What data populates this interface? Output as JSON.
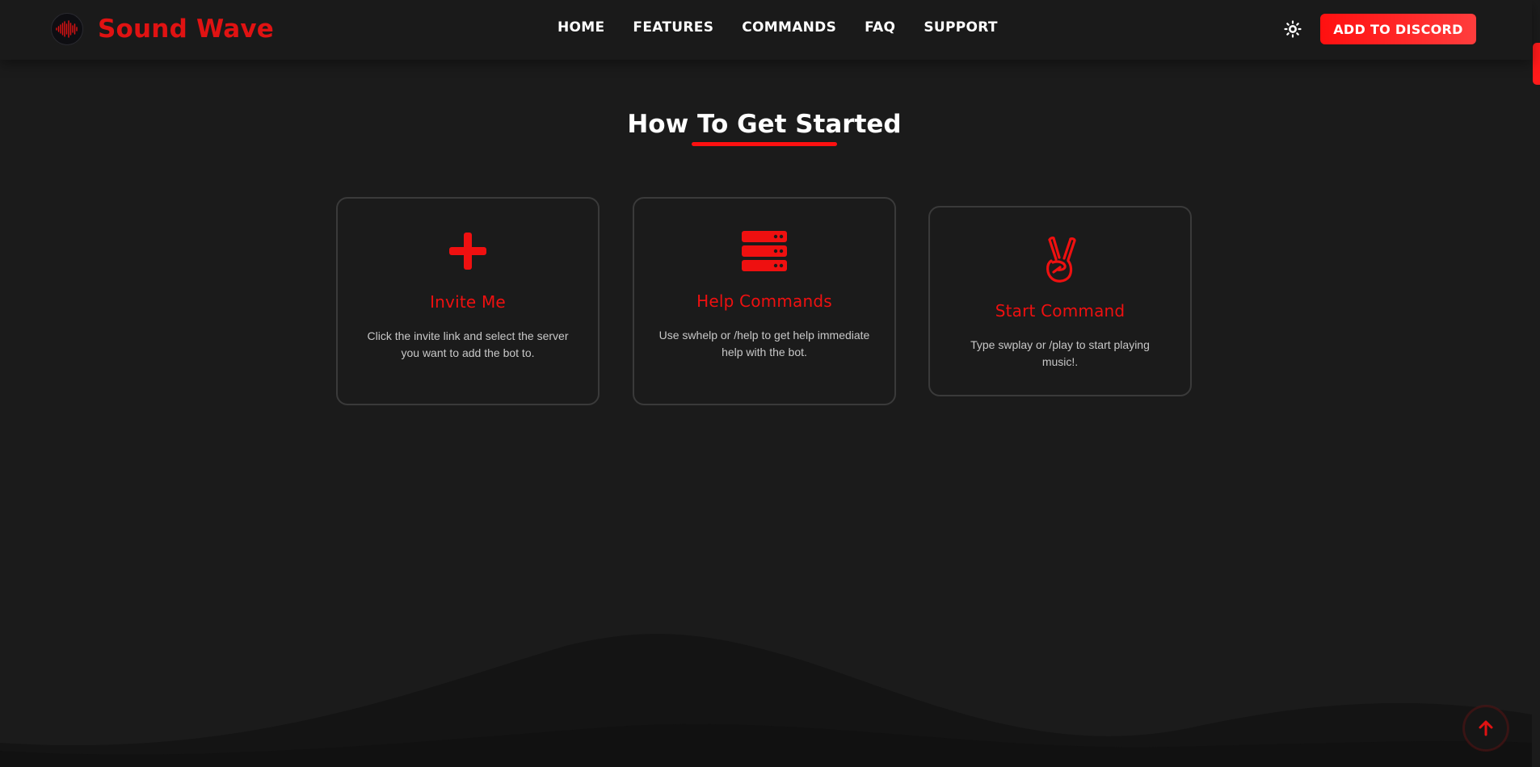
{
  "brand": {
    "name": "Sound Wave",
    "logo_icon": "waveform-icon"
  },
  "nav": {
    "items": [
      {
        "label": "HOME"
      },
      {
        "label": "FEATURES"
      },
      {
        "label": "COMMANDS"
      },
      {
        "label": "FAQ"
      },
      {
        "label": "SUPPORT"
      }
    ]
  },
  "header": {
    "theme_toggle_icon": "sun-icon",
    "cta_label": "ADD TO DISCORD"
  },
  "section": {
    "title": "How To Get Started"
  },
  "cards": [
    {
      "icon": "plus-icon",
      "title": "Invite Me",
      "description": "Click the invite link and select the server you want to add the bot to."
    },
    {
      "icon": "server-icon",
      "title": "Help Commands",
      "description": "Use swhelp or /help to get help immediate help with the bot."
    },
    {
      "icon": "peace-hand-icon",
      "title": "Start Command",
      "description": "Type swplay or /play to start playing music!."
    }
  ],
  "back_to_top_icon": "arrow-up-icon",
  "colors": {
    "accent": "#ff1010",
    "background": "#1b1b1b",
    "header": "#1a1a1a",
    "card_border": "#3a3a3a"
  }
}
